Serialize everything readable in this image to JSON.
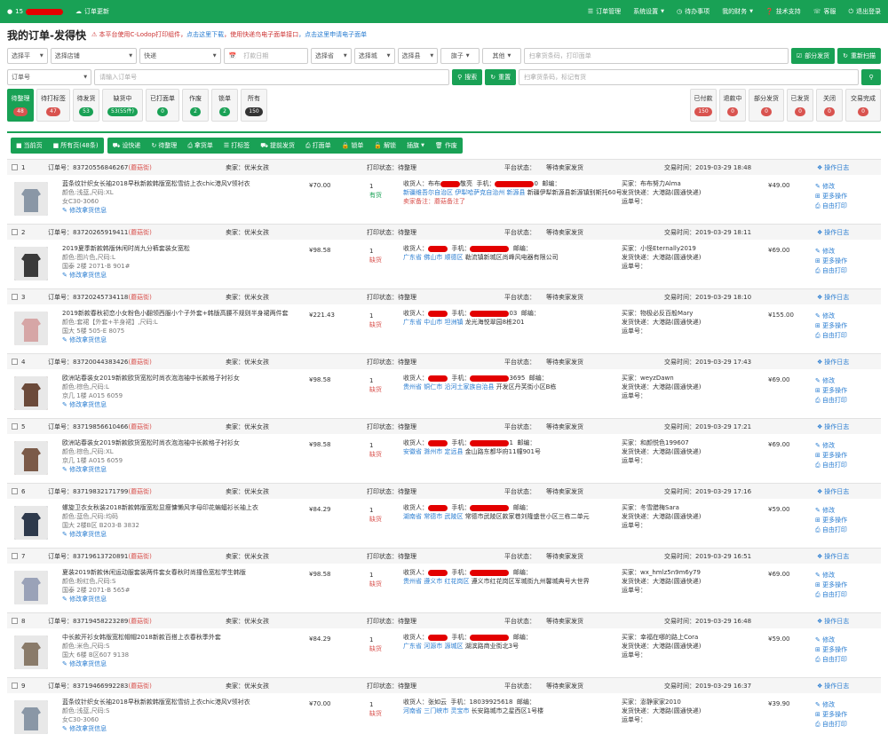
{
  "nav": {
    "user": "15",
    "update": "订单更新",
    "items": [
      "订单管理",
      "系统设置",
      "待办事项",
      "我的财务",
      "技术支持",
      "客服",
      "退出登录"
    ]
  },
  "title": {
    "page": "我的订单-发得快",
    "notice_pre": "本平台使用C-Lodop打印组件，",
    "notice_link1": "点击这里下载",
    "notice_mid": "，使用快递鸟电子面单接口",
    "notice_link2": "，点击这里申请电子面单"
  },
  "filters": {
    "platform": "选择平",
    "shop": "选择店铺",
    "express": "快递",
    "print_date": "打款日期",
    "province": "选择省",
    "city": "选择城",
    "county": "选择县",
    "flag": "旗子",
    "other": "其他",
    "scan_placeholder": "扫拿货条码，打印面单",
    "partial_ship": "部分发货",
    "rescan": "重新扫描",
    "order_type": "订单号",
    "order_placeholder": "请输入订单号",
    "search": "搜索",
    "reset": "重置",
    "scan2_placeholder": "扫拿货条码，标记有货"
  },
  "status_tabs_left": [
    {
      "label": "待整理",
      "count": "48",
      "style": "red"
    },
    {
      "label": "待打标签",
      "count": "47",
      "style": "red"
    },
    {
      "label": "待发货",
      "count": "53",
      "style": "green"
    },
    {
      "label": "缺货中",
      "count": "53(55件)",
      "style": "green"
    },
    {
      "label": "已打面单",
      "count": "0",
      "style": "green"
    },
    {
      "label": "作废",
      "count": "2",
      "style": "green"
    },
    {
      "label": "锁单",
      "count": "2",
      "style": "green"
    },
    {
      "label": "所有",
      "count": "150",
      "style": "dark"
    }
  ],
  "status_tabs_right": [
    {
      "label": "已付款",
      "count": "150"
    },
    {
      "label": "退款中",
      "count": "0"
    },
    {
      "label": "部分发货",
      "count": "0"
    },
    {
      "label": "已发货",
      "count": "0"
    },
    {
      "label": "关闭",
      "count": "0"
    },
    {
      "label": "交易完成",
      "count": "0"
    }
  ],
  "toolbar": {
    "group1": [
      "当前页",
      "所有页(48条)"
    ],
    "group2": [
      "设快递",
      "待整理",
      "拿货单",
      "打标签",
      "提前发货",
      "打面单",
      "锁单",
      "解锁",
      "插旗",
      "作废"
    ]
  },
  "labels": {
    "order_no": "订单号：",
    "seller": "卖家：优米女孩",
    "print_status": "打印状态：",
    "platform_status": "平台状态：",
    "waiting": "等待卖家发货",
    "trade_time": "交易时间：",
    "log": "操作日志",
    "edit_goods": "修改拿货信息",
    "receiver": "收货人：",
    "mobile": "手机：",
    "postcode": "邮编：",
    "buyer": "买家：",
    "ship_express": "发货快递：大港路(圆通快递)",
    "waybill": "运单号：",
    "act_edit": "修改",
    "act_more": "更多操作",
    "act_print": "自由打印"
  },
  "orders": [
    {
      "idx": "1",
      "no": "83720556846267",
      "tag": "(蘑菇街)",
      "status": "待整理",
      "time": "2019-03-29 18:48",
      "title": "蓝条纹针织女长袖2018早秋新款韩版宽松雪纺上衣chic港风V领衬衣",
      "spec": "颜色:浅蓝,尺码:XL",
      "sku": "女C30-3060",
      "price": "¥70.00",
      "qty": "1",
      "stock": "有货",
      "stock_style": "green",
      "recv_name": "布布",
      "recv_tail": "敬亮",
      "phone_tail": "0",
      "addr": "新疆维吾尔自治区 伊犁哈萨克自治州 新源县",
      "addr_extra": "新疆伊犁新源县新源镇别斯托60号",
      "remark": "卖家备注：蘑菇备注了",
      "buyer": "布布努力Alma",
      "amount": "¥49.00",
      "img": "#8a97a6"
    },
    {
      "idx": "2",
      "no": "83720265919411",
      "tag": "(蘑菇街)",
      "status": "待整理",
      "time": "2019-03-29 18:11",
      "title": "2019夏季新款韩版休闲时尚九分裤套装女宽松",
      "spec": "颜色:图片色,尺码:L",
      "sku": "国泰 2楼 2071-B 901#",
      "price": "¥98.58",
      "qty": "1",
      "stock": "缺货",
      "stock_style": "red",
      "recv_name": "",
      "recv_tail": "",
      "phone_tail": "",
      "addr": "广东省 佛山市 顺德区",
      "addr_extra": "勒流镇新城区尚峰风电器有限公司",
      "remark": "",
      "buyer": "小怪Eternally2019",
      "amount": "¥69.00",
      "img": "#3a3a3a"
    },
    {
      "idx": "3",
      "no": "83720245734118",
      "tag": "(蘑菇街)",
      "status": "待整理",
      "time": "2019-03-29 18:10",
      "title": "2019新款春秋初恋小女粉色小翻领西服小个子外套+韩版高腰不规则半身裙两件套",
      "spec": "颜色:套裙【外套+半身裙】,尺码:L",
      "sku": "国大 5楼 505-E 8075",
      "price": "¥221.43",
      "qty": "1",
      "stock": "缺货",
      "stock_style": "red",
      "recv_name": "",
      "recv_tail": "",
      "phone_tail": "03",
      "addr": "广东省 中山市 坦洲镇",
      "addr_extra": "龙光海悦翠园8栋201",
      "remark": "",
      "buyer": "物极必反百般Mary",
      "amount": "¥155.00",
      "img": "#d6a6a6"
    },
    {
      "idx": "4",
      "no": "83720044383426",
      "tag": "(蘑菇街)",
      "status": "待整理",
      "time": "2019-03-29 17:43",
      "title": "欧洲站春装女2019新款欧货宽松时尚衣泡泡袖中长款格子衬衫女",
      "spec": "颜色:棕色,尺码:L",
      "sku": "京几 1楼 A015 6059",
      "price": "¥98.58",
      "qty": "1",
      "stock": "缺货",
      "stock_style": "red",
      "recv_name": "",
      "recv_tail": "",
      "phone_tail": "3695",
      "addr": "贵州省 铜仁市 沿河土家族自治县",
      "addr_extra": "开发区丹芙街小区B栋",
      "remark": "",
      "buyer": "weyzDawn",
      "amount": "¥69.00",
      "img": "#6b4a3a"
    },
    {
      "idx": "5",
      "no": "83719856610466",
      "tag": "(蘑菇街)",
      "status": "待整理",
      "time": "2019-03-29 17:21",
      "title": "欧洲站春装女2019新款欧货宽松时尚衣泡泡袖中长款格子衬衫女",
      "spec": "颜色:棕色,尺码:XL",
      "sku": "京几 1楼 A015 6059",
      "price": "¥98.58",
      "qty": "1",
      "stock": "缺货",
      "stock_style": "red",
      "recv_name": "",
      "recv_tail": "",
      "phone_tail": "1",
      "addr": "安徽省 滁州市 定远县",
      "addr_extra": "金山路东都华府11幢901号",
      "remark": "",
      "buyer": "和颜悦色199607",
      "amount": "¥69.00",
      "img": "#7b5a48"
    },
    {
      "idx": "6",
      "no": "83719832171799",
      "tag": "(蘑菇街)",
      "status": "待整理",
      "time": "2019-03-29 17:16",
      "title": "螺旋卫衣女秋装2018新款韩版宽松显瘦慵懒风字母印花蝙蝠衫长袖上衣",
      "spec": "颜色:蓝色,尺码:均码",
      "sku": "国大 2楼B区 B203-B 3832",
      "price": "¥84.29",
      "qty": "1",
      "stock": "缺货",
      "stock_style": "red",
      "recv_name": "",
      "recv_tail": "",
      "phone_tail": "",
      "addr": "湖南省 常德市 武陵区",
      "addr_extra": "常德市武陵区款家巷刘隆盛世小区三栋二单元",
      "remark": "",
      "buyer": "冬雪腊梅Sara",
      "amount": "¥59.00",
      "img": "#2e3a4c"
    },
    {
      "idx": "7",
      "no": "83719613720891",
      "tag": "(蘑菇街)",
      "status": "待整理",
      "time": "2019-03-29 16:51",
      "title": "夏装2019新款休闲运动服套装两件套女春秋时尚撞色宽松学生韩版",
      "spec": "颜色:粉红色,尺码:S",
      "sku": "国泰 2楼 2071-B 565#",
      "price": "¥98.58",
      "qty": "1",
      "stock": "缺货",
      "stock_style": "red",
      "recv_name": "",
      "recv_tail": "",
      "phone_tail": "",
      "addr": "贵州省 遵义市 红花岗区",
      "addr_extra": "遵义市红花岗区军城街九州馨城典号大世界",
      "remark": "",
      "buyer": "wx_hmlz5n9m6y79",
      "amount": "¥69.00",
      "img": "#9aa2b8"
    },
    {
      "idx": "8",
      "no": "83719458223289",
      "tag": "(蘑菇街)",
      "status": "待整理",
      "time": "2019-03-29 16:48",
      "title": "中长款开衫女韩版宽松帽帽2018新款百搭上衣春秋季外套",
      "spec": "颜色:米色,尺码:S",
      "sku": "国大 6楼 B区607 9138",
      "price": "¥84.29",
      "qty": "1",
      "stock": "缺货",
      "stock_style": "red",
      "recv_name": "",
      "recv_tail": "",
      "phone_tail": "",
      "addr": "广东省 河源市 源城区",
      "addr_extra": "湖滨路商业街北3号",
      "remark": "",
      "buyer": "幸福在哪的路上Cora",
      "amount": "¥59.00",
      "img": "#8a7b6a"
    },
    {
      "idx": "9",
      "no": "83719466992283",
      "tag": "(蘑菇街)",
      "status": "待整理",
      "time": "2019-03-29 16:37",
      "title": "蓝条纹针织女长袖2018早秋新款韩版宽松雪纺上衣chic港风V领衬衣",
      "spec": "颜色:浅蓝,尺码:S",
      "sku": "女C30-3060",
      "price": "¥70.00",
      "qty": "1",
      "stock": "缺货",
      "stock_style": "red",
      "recv_name": "张如云",
      "recv_tail": "",
      "phone_tail": "18039925618",
      "addr": "河南省 三门峡市 灵宝市",
      "addr_extra": "长安路城市之星西区1号楼",
      "remark": "",
      "buyer": "澎静家家2010",
      "amount": "¥39.90",
      "img": "#8a97a6"
    }
  ]
}
